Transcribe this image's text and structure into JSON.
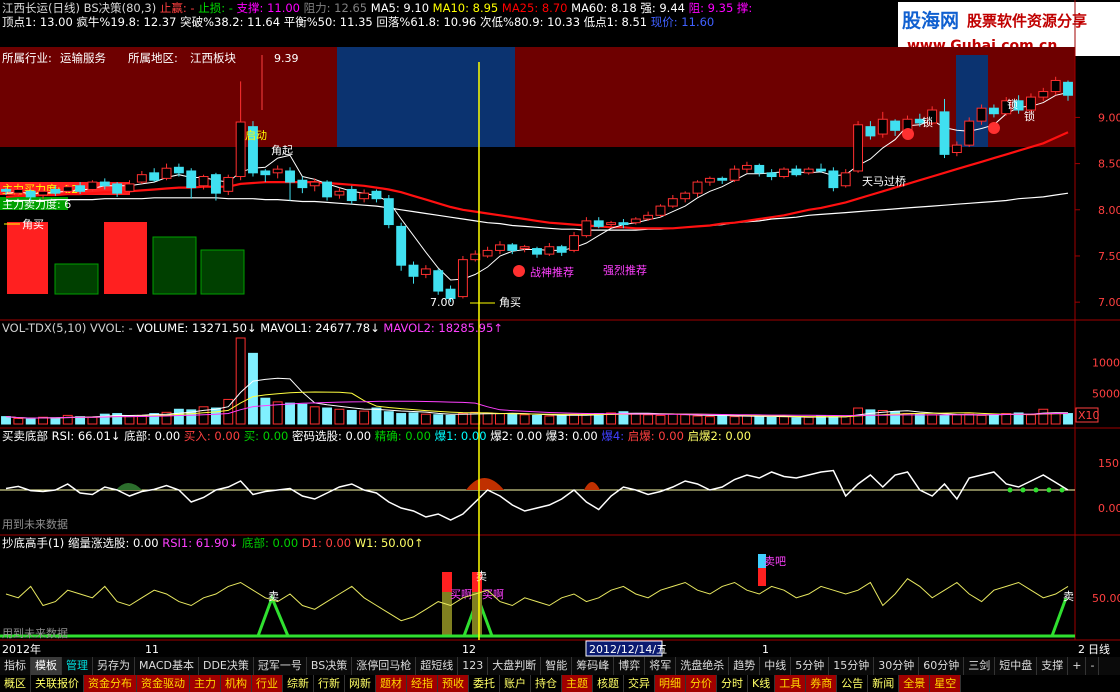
{
  "header": {
    "line1": [
      {
        "text": "江西长运(日线) BS决策(80,3)",
        "color": "#d8d8d8"
      },
      {
        "text": "止赢: -",
        "color": "#ff4040"
      },
      {
        "text": "止损: -",
        "color": "#00e000"
      },
      {
        "text": "支撑: 11.00",
        "color": "#ff00ff"
      },
      {
        "text": "阻力: 12.65",
        "color": "#808080"
      },
      {
        "text": "MA5: 9.10",
        "color": "#ffffff"
      },
      {
        "text": "MA10: 8.95",
        "color": "#ffff00"
      },
      {
        "text": "MA25: 8.70",
        "color": "#ff0000"
      },
      {
        "text": "MA60: 8.18",
        "color": "#ffffff"
      },
      {
        "text": "强: 9.44",
        "color": "#ffffff"
      },
      {
        "text": "阻: 9.35",
        "color": "#ff00ff"
      },
      {
        "text": "撑:",
        "color": "#ff00ff"
      }
    ],
    "line2": [
      {
        "text": "顶点1: 13.00",
        "color": "#ffffff"
      },
      {
        "text": "疯牛%19.8: 12.37",
        "color": "#ffffff"
      },
      {
        "text": "突破%38.2: 11.64",
        "color": "#ffffff"
      },
      {
        "text": "平衡%50: 11.35",
        "color": "#ffffff"
      },
      {
        "text": "回落%61.8: 10.96",
        "color": "#ffffff"
      },
      {
        "text": "次低%80.9: 10.33",
        "color": "#ffffff"
      },
      {
        "text": "低点1: 8.51",
        "color": "#ffffff"
      },
      {
        "text": "现价: 11.60",
        "color": "#4060ff"
      }
    ]
  },
  "logo": {
    "title": "股海网",
    "subtitle": "股票软件资源分享",
    "url": "www.Guhai.com.cn"
  },
  "main": {
    "industry_label": "所属行业:",
    "industry": "运输服务",
    "region_label": "所属地区:",
    "region": "江西板块",
    "buy_power": "主力买力度: 12",
    "sell_power": "主力卖力度: 6",
    "y_ticks": [
      "9.00",
      "8.50",
      "8.00",
      "7.50",
      "7.00"
    ],
    "labels": {
      "high": "9.39",
      "low": "7.00",
      "jiaomai": "角买",
      "jiaomai2": "角买",
      "qidong": "启动",
      "jiaoqi": "角起",
      "zhanshen": "战神推荐",
      "qianglie": "强烈推荐",
      "tianma": "天马过桥",
      "suo1": "锁",
      "suo2": "锁",
      "suo3": "锁"
    }
  },
  "volume": {
    "header": [
      {
        "text": "VOL-TDX(5,10) VVOL: -",
        "color": "#d0d0d0"
      },
      {
        "text": "VOLUME: 13271.50↓",
        "color": "#ffffff"
      },
      {
        "text": "MAVOL1: 24677.78↓",
        "color": "#ffffff"
      },
      {
        "text": "MAVOL2: 18285.95↑",
        "color": "#ff40ff"
      }
    ],
    "y_ticks": [
      "10000",
      "5000",
      "X10"
    ]
  },
  "rsi": {
    "header": [
      {
        "text": "买卖底部 RSI: 66.01↓",
        "color": "#ffffff"
      },
      {
        "text": "底部: 0.00",
        "color": "#ffffff"
      },
      {
        "text": "买入: 0.00",
        "color": "#ff4040"
      },
      {
        "text": "买: 0.00",
        "color": "#00d000"
      },
      {
        "text": "密码选股: 0.00",
        "color": "#ffffff"
      },
      {
        "text": "精确: 0.00",
        "color": "#00d000"
      },
      {
        "text": "爆1: 0.00",
        "color": "#00ffff"
      },
      {
        "text": "爆2: 0.00",
        "color": "#ffffff"
      },
      {
        "text": "爆3: 0.00",
        "color": "#ffffff"
      },
      {
        "text": "爆4:",
        "color": "#4040ff"
      },
      {
        "text": "启爆: 0.00",
        "color": "#ff4040"
      },
      {
        "text": "启爆2: 0.00",
        "color": "#ffff66"
      }
    ],
    "y_ticks": [
      "150.00",
      "0.00"
    ],
    "note": "用到未来数据"
  },
  "bottom": {
    "header": [
      {
        "text": "抄底高手(1) 缩量涨选股: 0.00",
        "color": "#ffffff"
      },
      {
        "text": "RSI1: 61.90↓",
        "color": "#ff40ff"
      },
      {
        "text": "底部: 0.00",
        "color": "#00d000"
      },
      {
        "text": "D1: 0.00",
        "color": "#ff4040"
      },
      {
        "text": "W1: 50.00↑",
        "color": "#ffff66"
      }
    ],
    "y_ticks": [
      "50.00"
    ],
    "note": "用到未来数据",
    "labels": {
      "mai1": "卖",
      "mai2": "卖",
      "mai3": "卖",
      "maia": "买啊",
      "maia2": "买啊",
      "maiba": "卖吧"
    }
  },
  "time_axis": {
    "labels": [
      "2012年",
      "11",
      "12",
      "2012/12/14/五",
      "1",
      "2"
    ],
    "right_label": "日线"
  },
  "tabs_row1": [
    {
      "label": "指标",
      "style": ""
    },
    {
      "label": "模板",
      "style": "on"
    },
    {
      "label": "管理",
      "style": "tm"
    },
    {
      "label": "另存为",
      "style": ""
    },
    {
      "label": "MACD基本",
      "style": ""
    },
    {
      "label": "DDE决策",
      "style": ""
    },
    {
      "label": "冠军一号",
      "style": ""
    },
    {
      "label": "BS决策",
      "style": ""
    },
    {
      "label": "涨停回马枪",
      "style": ""
    },
    {
      "label": "超短线",
      "style": ""
    },
    {
      "label": "123",
      "style": ""
    },
    {
      "label": "大盘判断",
      "style": ""
    },
    {
      "label": "智能",
      "style": ""
    },
    {
      "label": "筹码峰",
      "style": ""
    },
    {
      "label": "博弈",
      "style": ""
    },
    {
      "label": "将军",
      "style": ""
    },
    {
      "label": "洗盘绝杀",
      "style": ""
    },
    {
      "label": "趋势",
      "style": ""
    },
    {
      "label": "中线",
      "style": ""
    },
    {
      "label": "5分钟",
      "style": ""
    },
    {
      "label": "15分钟",
      "style": ""
    },
    {
      "label": "30分钟",
      "style": ""
    },
    {
      "label": "60分钟",
      "style": ""
    },
    {
      "label": "三剑",
      "style": ""
    },
    {
      "label": "短中盘",
      "style": ""
    },
    {
      "label": "支撑",
      "style": ""
    },
    {
      "label": "+",
      "style": ""
    },
    {
      "label": "-",
      "style": ""
    }
  ],
  "tabs_row2": [
    {
      "label": "概区",
      "style": "plain"
    },
    {
      "label": "关联报价",
      "style": "plain"
    },
    {
      "label": "资金分布",
      "style": "act"
    },
    {
      "label": "资金驱动",
      "style": "act"
    },
    {
      "label": "主力",
      "style": "act"
    },
    {
      "label": "机构",
      "style": "act"
    },
    {
      "label": "行业",
      "style": "act"
    },
    {
      "label": "综新",
      "style": "plain"
    },
    {
      "label": "行新",
      "style": "plain"
    },
    {
      "label": "网新",
      "style": "plain"
    },
    {
      "label": "题材",
      "style": "act"
    },
    {
      "label": "经指",
      "style": "act"
    },
    {
      "label": "预收",
      "style": "act"
    },
    {
      "label": "委托",
      "style": "plain"
    },
    {
      "label": "账户",
      "style": "plain"
    },
    {
      "label": "持仓",
      "style": "plain"
    },
    {
      "label": "主题",
      "style": "act"
    },
    {
      "label": "核题",
      "style": "plain"
    },
    {
      "label": "交异",
      "style": "plain"
    },
    {
      "label": "明细",
      "style": "act"
    },
    {
      "label": "分价",
      "style": "act"
    },
    {
      "label": "分时",
      "style": "plain"
    },
    {
      "label": "K线",
      "style": "plain"
    },
    {
      "label": "工具",
      "style": "act"
    },
    {
      "label": "券商",
      "style": "act"
    },
    {
      "label": "公告",
      "style": "plain"
    },
    {
      "label": "新闻",
      "style": "plain"
    },
    {
      "label": "全景",
      "style": "act"
    },
    {
      "label": "星空",
      "style": "act"
    }
  ],
  "chart_data": {
    "type": "candlestick",
    "price_ylim": [
      6.85,
      9.6
    ],
    "candles": [
      [
        8.22,
        8.2,
        8.24,
        8.16
      ],
      [
        8.18,
        8.22,
        8.25,
        8.15
      ],
      [
        8.2,
        8.14,
        8.22,
        8.1
      ],
      [
        8.16,
        8.2,
        8.22,
        8.12
      ],
      [
        8.22,
        8.18,
        8.26,
        8.15
      ],
      [
        8.2,
        8.25,
        8.28,
        8.18
      ],
      [
        8.26,
        8.2,
        8.3,
        8.17
      ],
      [
        8.22,
        8.3,
        8.32,
        8.2
      ],
      [
        8.3,
        8.26,
        8.34,
        8.22
      ],
      [
        8.28,
        8.18,
        8.3,
        8.14
      ],
      [
        8.2,
        8.28,
        8.32,
        8.18
      ],
      [
        8.3,
        8.38,
        8.42,
        8.28
      ],
      [
        8.4,
        8.32,
        8.45,
        8.3
      ],
      [
        8.34,
        8.45,
        8.5,
        8.32
      ],
      [
        8.46,
        8.4,
        8.5,
        8.36
      ],
      [
        8.42,
        8.24,
        8.45,
        8.12
      ],
      [
        8.26,
        8.36,
        8.38,
        8.22
      ],
      [
        8.38,
        8.18,
        8.4,
        8.1
      ],
      [
        8.2,
        8.35,
        8.38,
        8.16
      ],
      [
        8.36,
        8.95,
        9.39,
        8.32
      ],
      [
        8.9,
        8.4,
        8.96,
        8.36
      ],
      [
        8.42,
        8.38,
        8.44,
        8.3
      ],
      [
        8.4,
        8.44,
        8.48,
        8.34
      ],
      [
        8.42,
        8.3,
        8.46,
        8.1
      ],
      [
        8.32,
        8.24,
        8.36,
        8.18
      ],
      [
        8.26,
        8.3,
        8.34,
        8.2
      ],
      [
        8.3,
        8.14,
        8.32,
        8.1
      ],
      [
        8.16,
        8.2,
        8.24,
        8.12
      ],
      [
        8.22,
        8.1,
        8.26,
        8.06
      ],
      [
        8.12,
        8.18,
        8.22,
        8.08
      ],
      [
        8.2,
        8.12,
        8.22,
        8.08
      ],
      [
        8.12,
        7.84,
        8.16,
        7.8
      ],
      [
        7.82,
        7.4,
        7.86,
        7.34
      ],
      [
        7.4,
        7.28,
        7.44,
        7.2
      ],
      [
        7.3,
        7.36,
        7.4,
        7.26
      ],
      [
        7.34,
        7.12,
        7.36,
        7.08
      ],
      [
        7.14,
        7.04,
        7.18,
        7.0
      ],
      [
        7.06,
        7.46,
        7.5,
        7.04
      ],
      [
        7.46,
        7.52,
        7.56,
        7.44
      ],
      [
        7.5,
        7.56,
        7.6,
        7.48
      ],
      [
        7.56,
        7.62,
        7.66,
        7.52
      ],
      [
        7.62,
        7.56,
        7.64,
        7.52
      ],
      [
        7.58,
        7.6,
        7.62,
        7.54
      ],
      [
        7.58,
        7.52,
        7.6,
        7.48
      ],
      [
        7.52,
        7.6,
        7.64,
        7.5
      ],
      [
        7.6,
        7.54,
        7.62,
        7.5
      ],
      [
        7.56,
        7.72,
        7.76,
        7.54
      ],
      [
        7.72,
        7.88,
        7.92,
        7.7
      ],
      [
        7.88,
        7.82,
        7.92,
        7.8
      ],
      [
        7.84,
        7.86,
        7.88,
        7.82
      ],
      [
        7.86,
        7.84,
        7.9,
        7.8
      ],
      [
        7.86,
        7.9,
        7.92,
        7.84
      ],
      [
        7.9,
        7.94,
        7.98,
        7.88
      ],
      [
        7.94,
        8.04,
        8.06,
        7.92
      ],
      [
        8.04,
        8.12,
        8.16,
        8.02
      ],
      [
        8.12,
        8.18,
        8.2,
        8.08
      ],
      [
        8.18,
        8.3,
        8.32,
        8.14
      ],
      [
        8.3,
        8.34,
        8.36,
        8.26
      ],
      [
        8.34,
        8.32,
        8.36,
        8.28
      ],
      [
        8.32,
        8.44,
        8.48,
        8.3
      ],
      [
        8.44,
        8.48,
        8.52,
        8.4
      ],
      [
        8.48,
        8.4,
        8.5,
        8.36
      ],
      [
        8.4,
        8.36,
        8.44,
        8.32
      ],
      [
        8.36,
        8.44,
        8.46,
        8.34
      ],
      [
        8.44,
        8.38,
        8.48,
        8.36
      ],
      [
        8.4,
        8.44,
        8.46,
        8.38
      ],
      [
        8.44,
        8.42,
        8.5,
        8.4
      ],
      [
        8.42,
        8.24,
        8.46,
        8.2
      ],
      [
        8.26,
        8.4,
        8.44,
        8.24
      ],
      [
        8.42,
        8.92,
        8.96,
        8.4
      ],
      [
        8.9,
        8.8,
        8.96,
        8.76
      ],
      [
        8.82,
        8.98,
        9.06,
        8.78
      ],
      [
        8.96,
        8.86,
        8.98,
        8.8
      ],
      [
        8.86,
        8.98,
        9.02,
        8.84
      ],
      [
        8.98,
        8.94,
        9.04,
        8.9
      ],
      [
        8.94,
        9.08,
        9.12,
        8.92
      ],
      [
        9.06,
        8.6,
        9.2,
        8.56
      ],
      [
        8.62,
        8.7,
        8.74,
        8.58
      ],
      [
        8.7,
        8.96,
        9.0,
        8.68
      ],
      [
        8.96,
        9.1,
        9.14,
        8.92
      ],
      [
        9.1,
        9.04,
        9.14,
        9.0
      ],
      [
        9.04,
        9.18,
        9.22,
        9.02
      ],
      [
        9.18,
        9.08,
        9.24,
        9.04
      ],
      [
        9.08,
        9.22,
        9.26,
        9.06
      ],
      [
        9.22,
        9.28,
        9.32,
        9.18
      ],
      [
        9.28,
        9.4,
        9.44,
        9.24
      ],
      [
        9.38,
        9.24,
        9.4,
        9.18
      ]
    ],
    "ma5": [
      8.18,
      8.19,
      8.18,
      8.18,
      8.19,
      8.2,
      8.21,
      8.23,
      8.26,
      8.26,
      8.26,
      8.28,
      8.3,
      8.35,
      8.38,
      8.35,
      8.35,
      8.32,
      8.3,
      8.41,
      8.45,
      8.46,
      8.56,
      8.59,
      8.36,
      8.33,
      8.28,
      8.24,
      8.2,
      8.18,
      8.15,
      8.09,
      7.9,
      7.72,
      7.54,
      7.37,
      7.24,
      7.25,
      7.3,
      7.38,
      7.5,
      7.55,
      7.57,
      7.57,
      7.56,
      7.56,
      7.59,
      7.64,
      7.72,
      7.8,
      7.84,
      7.86,
      7.89,
      7.92,
      7.98,
      8.04,
      8.13,
      8.2,
      8.25,
      8.32,
      8.39,
      8.39,
      8.4,
      8.41,
      8.41,
      8.4,
      8.41,
      8.37,
      8.38,
      8.48,
      8.55,
      8.67,
      8.76,
      8.91,
      8.92,
      8.97,
      8.89,
      8.86,
      8.85,
      8.88,
      8.92,
      9.04,
      9.11,
      9.12,
      9.16,
      9.24,
      9.27
    ],
    "ma25": [
      8.14,
      8.15,
      8.15,
      8.16,
      8.16,
      8.17,
      8.17,
      8.18,
      8.19,
      8.19,
      8.2,
      8.21,
      8.22,
      8.23,
      8.24,
      8.24,
      8.25,
      8.25,
      8.25,
      8.28,
      8.29,
      8.3,
      8.3,
      8.3,
      8.3,
      8.3,
      8.29,
      8.28,
      8.27,
      8.26,
      8.24,
      8.22,
      8.19,
      8.15,
      8.11,
      8.07,
      8.03,
      8.0,
      7.98,
      7.96,
      7.94,
      7.92,
      7.9,
      7.88,
      7.86,
      7.85,
      7.84,
      7.83,
      7.82,
      7.81,
      7.81,
      7.8,
      7.8,
      7.8,
      7.8,
      7.81,
      7.82,
      7.83,
      7.85,
      7.86,
      7.88,
      7.9,
      7.92,
      7.94,
      7.97,
      8.0,
      8.02,
      8.05,
      8.08,
      8.12,
      8.16,
      8.2,
      8.24,
      8.28,
      8.32,
      8.36,
      8.4,
      8.44,
      8.48,
      8.52,
      8.56,
      8.6,
      8.64,
      8.68,
      8.72,
      8.78,
      8.84
    ],
    "ma60": [
      8.1,
      8.1,
      8.1,
      8.1,
      8.11,
      8.11,
      8.11,
      8.11,
      8.12,
      8.12,
      8.12,
      8.12,
      8.13,
      8.13,
      8.13,
      8.13,
      8.13,
      8.13,
      8.12,
      8.12,
      8.12,
      8.11,
      8.11,
      8.1,
      8.09,
      8.09,
      8.08,
      8.07,
      8.06,
      8.05,
      8.04,
      8.02,
      8.0,
      7.98,
      7.96,
      7.94,
      7.92,
      7.9,
      7.88,
      7.86,
      7.85,
      7.83,
      7.82,
      7.81,
      7.8,
      7.79,
      7.79,
      7.78,
      7.78,
      7.78,
      7.78,
      7.78,
      7.79,
      7.79,
      7.8,
      7.81,
      7.82,
      7.83,
      7.84,
      7.86,
      7.87,
      7.88,
      7.9,
      7.91,
      7.92,
      7.94,
      7.95,
      7.96,
      7.97,
      7.98,
      7.99,
      8.0,
      8.01,
      8.02,
      8.03,
      8.04,
      8.05,
      8.06,
      8.07,
      8.08,
      8.09,
      8.1,
      8.12,
      8.13,
      8.14,
      8.16,
      8.18
    ],
    "volume": [
      1200,
      900,
      800,
      1100,
      1000,
      1400,
      1200,
      1100,
      1600,
      1700,
      1300,
      1400,
      1700,
      1900,
      2400,
      2300,
      2800,
      2600,
      4000,
      14000,
      11500,
      4200,
      3600,
      3400,
      3200,
      2800,
      2600,
      2400,
      2200,
      2100,
      2600,
      2000,
      1700,
      1800,
      1600,
      1500,
      1400,
      1700,
      1900,
      1800,
      1700,
      1600,
      1500,
      1400,
      1300,
      1400,
      1500,
      1600,
      1700,
      1800,
      2000,
      1700,
      1500,
      1400,
      1600,
      1500,
      1300,
      1200,
      1400,
      1200,
      1300,
      1200,
      1100,
      1200,
      1000,
      1100,
      1300,
      1200,
      1200,
      2600,
      2300,
      2200,
      2000,
      1700,
      1600,
      1500,
      1400,
      1500,
      1600,
      1400,
      1500,
      1700,
      1800,
      1500,
      2400,
      1800,
      1700
    ],
    "vol_ylim": [
      0,
      14000
    ],
    "rsi": [
      65,
      72,
      58,
      55,
      60,
      80,
      50,
      45,
      70,
      60,
      40,
      55,
      62,
      75,
      60,
      20,
      35,
      60,
      70,
      90,
      45,
      55,
      60,
      65,
      40,
      30,
      50,
      70,
      80,
      60,
      50,
      20,
      0,
      -10,
      -30,
      -20,
      -40,
      -20,
      20,
      60,
      40,
      10,
      -10,
      0,
      10,
      30,
      60,
      20,
      -5,
      40,
      70,
      60,
      45,
      55,
      70,
      90,
      80,
      60,
      70,
      95,
      110,
      100,
      120,
      105,
      100,
      110,
      120,
      125,
      40,
      80,
      110,
      70,
      110,
      120,
      60,
      40,
      80,
      30,
      100,
      110,
      120,
      80,
      70,
      90,
      110,
      85,
      60
    ],
    "rsi_ylim": [
      -80,
      200
    ],
    "rsi1": [
      55,
      50,
      65,
      40,
      45,
      60,
      55,
      50,
      65,
      45,
      40,
      50,
      60,
      55,
      45,
      40,
      50,
      55,
      65,
      70,
      60,
      50,
      45,
      55,
      40,
      35,
      45,
      55,
      65,
      50,
      40,
      30,
      20,
      25,
      35,
      45,
      40,
      50,
      55,
      60,
      45,
      40,
      50,
      45,
      40,
      50,
      55,
      45,
      50,
      60,
      65,
      55,
      50,
      60,
      65,
      70,
      60,
      55,
      65,
      70,
      60,
      55,
      65,
      60,
      50,
      55,
      65,
      60,
      55,
      60,
      70,
      40,
      55,
      75,
      65,
      50,
      60,
      70,
      55,
      45,
      60,
      65,
      70,
      60,
      50,
      55,
      65
    ],
    "rsi1_ylim": [
      0,
      110
    ]
  }
}
